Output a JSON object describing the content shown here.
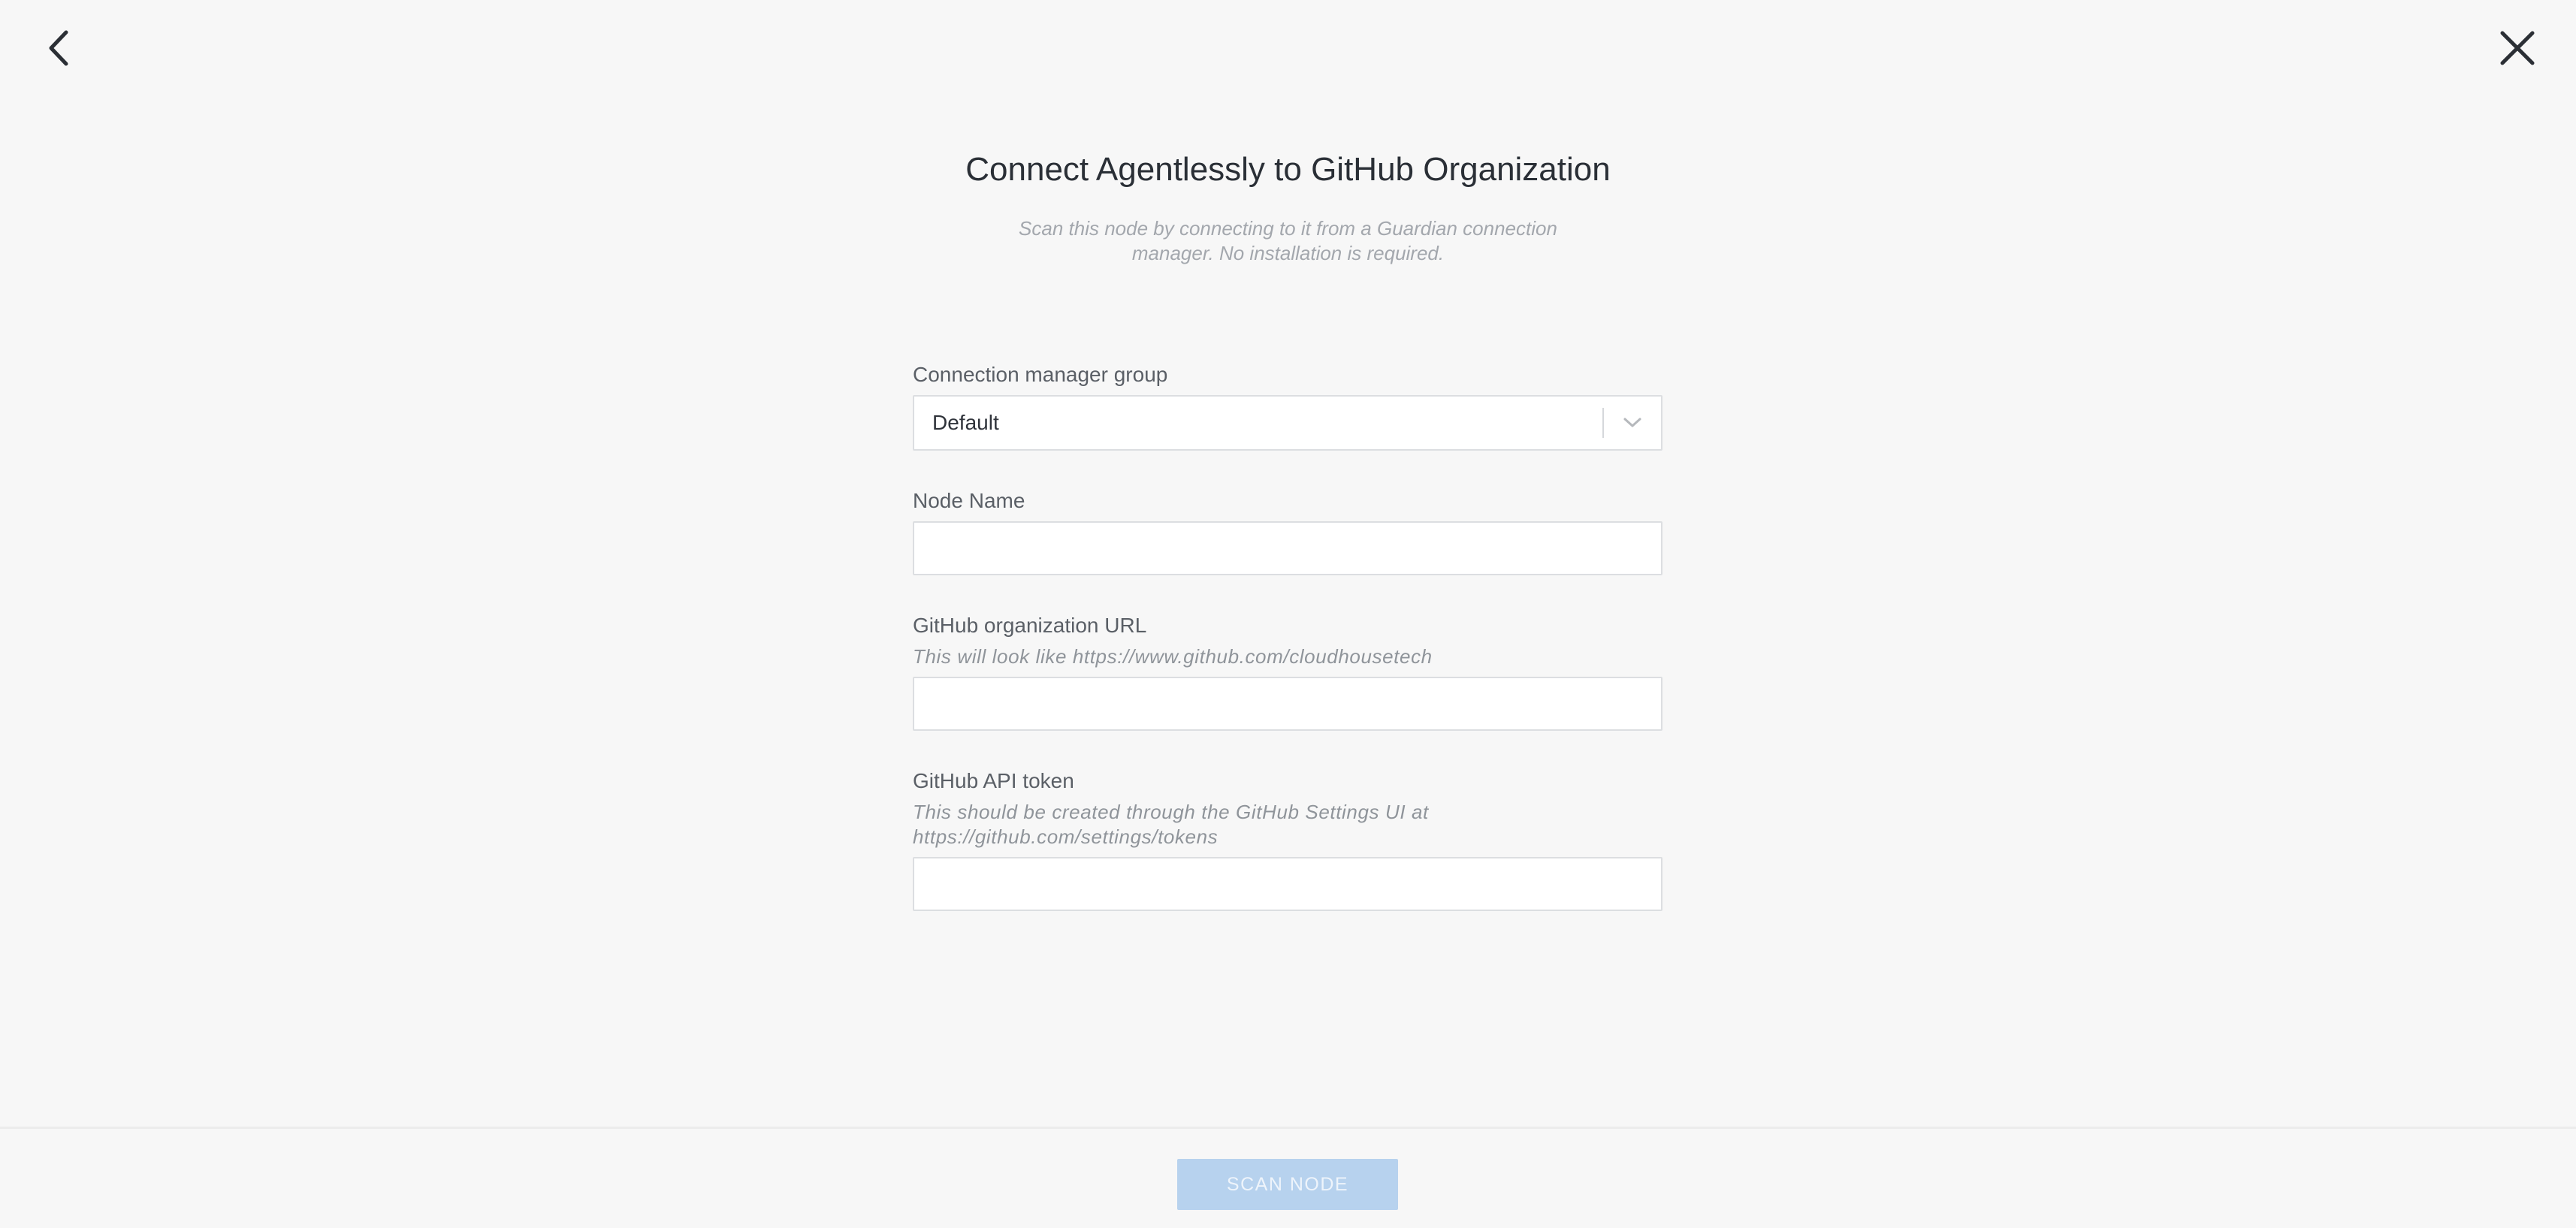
{
  "header": {
    "title": "Connect Agentlessly to GitHub Organization",
    "subtitle": "Scan this node by connecting to it from a Guardian connection manager. No installation is required."
  },
  "form": {
    "connection_group": {
      "label": "Connection manager group",
      "value": "Default"
    },
    "node_name": {
      "label": "Node Name",
      "value": "",
      "placeholder": ""
    },
    "org_url": {
      "label": "GitHub organization URL",
      "hint": "This will look like https://www.github.com/cloudhousetech",
      "value": "",
      "placeholder": ""
    },
    "api_token": {
      "label": "GitHub API token",
      "hint": "This should be created through the GitHub Settings UI at https://github.com/settings/tokens",
      "value": "",
      "placeholder": ""
    }
  },
  "footer": {
    "scan_label": "SCAN NODE"
  },
  "icons": {
    "back": "chevron-left-icon",
    "close": "close-icon",
    "dropdown": "chevron-down-icon"
  },
  "colors": {
    "background": "#f7f7f7",
    "primary_disabled": "#b7d2ee",
    "title": "#2a2f36"
  }
}
